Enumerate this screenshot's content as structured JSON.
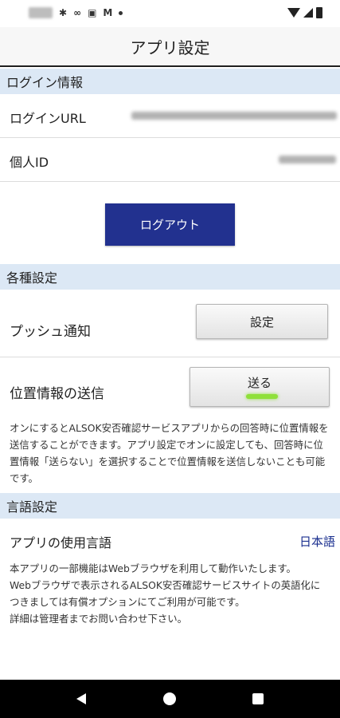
{
  "title": "アプリ設定",
  "login_section": {
    "header": "ログイン情報",
    "url_label": "ログインURL",
    "id_label": "個人ID",
    "logout_button": "ログアウト"
  },
  "settings_section": {
    "header": "各種設定",
    "push_label": "プッシュ通知",
    "push_button": "設定",
    "location_label": "位置情報の送信",
    "location_button": "送る",
    "location_note": "オンにするとALSOK安否確認サービスアプリからの回答時に位置情報を送信することができます。アプリ設定でオンに設定しても、回答時に位置情報「送らない」を選択することで位置情報を送信しないことも可能です。"
  },
  "language_section": {
    "header": "言語設定",
    "label": "アプリの使用言語",
    "value": "日本語",
    "note_line1": "本アプリの一部機能はWebブラウザを利用して動作いたします。",
    "note_line2": "Webブラウザで表示されるALSOK安否確認サービスサイトの英語化につきましては有償オプションにてご利用が可能です。",
    "note_line3": "詳細は管理者までお問い合わせ下さい。"
  },
  "colors": {
    "section_bg": "#dce8f5",
    "logout_bg": "#22318f",
    "language_value": "#1a2f8f",
    "send_indicator": "#8fe03a"
  }
}
